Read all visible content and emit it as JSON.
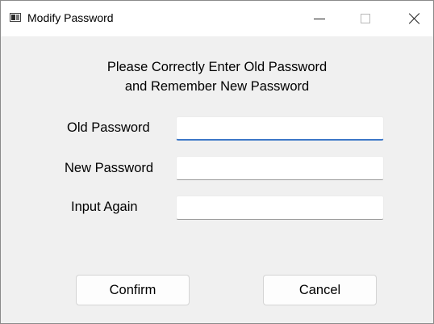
{
  "window": {
    "title": "Modify Password",
    "icon": "app-window-icon",
    "controls": [
      "minimize-icon",
      "maximize-icon",
      "close-icon"
    ]
  },
  "heading": {
    "line1": "Please Correctly Enter Old Password",
    "line2": "and Remember New Password"
  },
  "form": {
    "old_password": {
      "label": "Old Password",
      "value": ""
    },
    "new_password": {
      "label": "New Password",
      "value": ""
    },
    "input_again": {
      "label": "Input Again",
      "value": ""
    }
  },
  "buttons": {
    "confirm": "Confirm",
    "cancel": "Cancel"
  },
  "colors": {
    "focus_accent": "#3d78c7",
    "dialog_background": "#f0f0f0"
  }
}
